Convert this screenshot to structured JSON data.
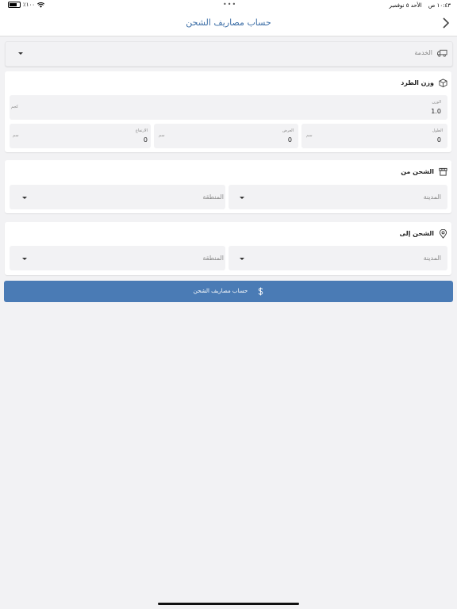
{
  "status_bar": {
    "time": "١٠:٤٣ ص",
    "date": "الأحد ٥ نوفمبر",
    "battery": "٪١٠٠",
    "center_dots": "•••"
  },
  "nav": {
    "title": "حساب مصاريف الشحن"
  },
  "service": {
    "placeholder": "الخدمة"
  },
  "package": {
    "title": "وزن الطرد",
    "weight_label": "الوزن",
    "weight_value": "1.0",
    "weight_unit": "كجم",
    "length_label": "الطول",
    "length_value": "0",
    "width_label": "العرض",
    "width_value": "0",
    "height_label": "الارتفاع",
    "height_value": "0",
    "dim_unit": "سم"
  },
  "ship_from": {
    "title": "الشحن من",
    "city_placeholder": "المدينة",
    "region_placeholder": "المنطقة"
  },
  "ship_to": {
    "title": "الشحن إلى",
    "city_placeholder": "المدينة",
    "region_placeholder": "المنطقة"
  },
  "submit": {
    "label": "حساب مصاريف الشحن"
  },
  "colors": {
    "accent": "#4a7bb5",
    "title": "#3c6ea6",
    "background": "#f2f2f4"
  }
}
